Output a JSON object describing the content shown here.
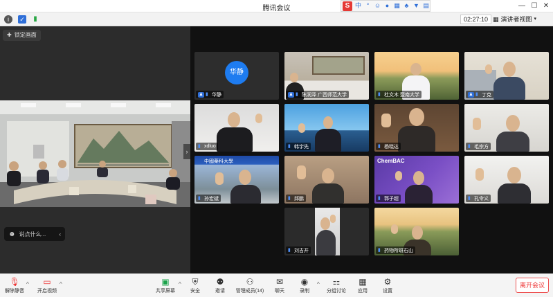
{
  "window": {
    "title": "腾讯会议",
    "controls": [
      "—",
      "☐",
      "✕"
    ]
  },
  "ime": {
    "logo": "S",
    "mode": "中"
  },
  "infobar": {
    "timer": "02:27:10",
    "view_label": "演讲者视图"
  },
  "left_panel": {
    "lock_label": "锁定画面",
    "chat_placeholder": "说点什么..."
  },
  "participants": [
    {
      "name": "华静",
      "avatar": "华静",
      "type": "avatar",
      "host": true
    },
    {
      "name": "陈润泽 广西师范大学",
      "type": "video",
      "host": true
    },
    {
      "name": "杜文木 暨南大学",
      "type": "video",
      "host": false
    },
    {
      "name": "丁克",
      "type": "video",
      "host": true
    },
    {
      "name": "xdluo",
      "type": "video",
      "host": false
    },
    {
      "name": "韩宇先",
      "type": "video",
      "host": false
    },
    {
      "name": "杨晓达",
      "type": "video",
      "host": false
    },
    {
      "name": "毛宗方",
      "type": "video",
      "host": false
    },
    {
      "name": "孙宏斌",
      "type": "video",
      "host": false
    },
    {
      "name": "邱鹏",
      "type": "video",
      "host": false
    },
    {
      "name": "郭子超",
      "type": "video",
      "host": false
    },
    {
      "name": "孔令义",
      "type": "video",
      "host": false
    },
    {
      "name": "刘吉开",
      "type": "video",
      "host": false
    },
    {
      "name": "药物所斑石山",
      "type": "video",
      "host": false
    }
  ],
  "tile_texts": {
    "logo_text": "中國藥科大學",
    "chembac_text": "ChemBAC"
  },
  "toolbar": {
    "unmute": "解除静音",
    "video": "开启视频",
    "share": "共享屏幕",
    "security": "安全",
    "invite": "邀请",
    "members": "管理成员(14)",
    "chat": "聊天",
    "record": "录制",
    "breakout": "分组讨论",
    "apps": "应用",
    "settings": "设置",
    "leave": "离开会议"
  }
}
